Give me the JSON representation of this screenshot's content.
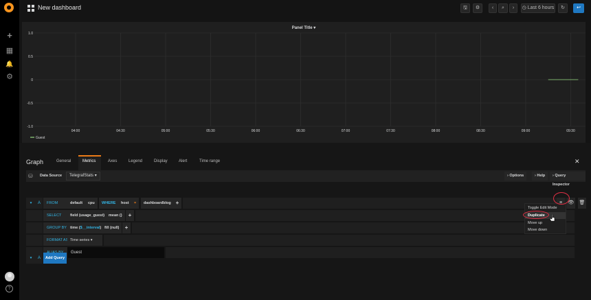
{
  "app": {
    "logo_icon": "grafana-logo-icon"
  },
  "sidebar": {
    "items": [
      {
        "icon": "plus-icon",
        "glyph": "+"
      },
      {
        "icon": "dashboards-icon",
        "glyph": "▦"
      },
      {
        "icon": "bell-icon",
        "glyph": "🔔"
      },
      {
        "icon": "gear-icon",
        "glyph": "⚙"
      }
    ],
    "help_glyph": "?"
  },
  "topnav": {
    "title": "New dashboard",
    "save_glyph": "🖫",
    "settings_glyph": "⚙",
    "back_glyph": "‹",
    "zoom_glyph": "⌕",
    "forward_glyph": "›",
    "time_range": "Last 6 hours",
    "time_icon": "clock-icon",
    "refresh_glyph": "↻",
    "return_glyph": "↩"
  },
  "panel": {
    "title": "Panel Title",
    "title_caret": "▾"
  },
  "chart_data": {
    "type": "line",
    "title": "Panel Title",
    "xlabel": "",
    "ylabel": "",
    "ylim": [
      -1.0,
      1.0
    ],
    "y_ticks": [
      "1.0",
      "0.5",
      "0",
      "-0.5",
      "-1.0"
    ],
    "x_ticks": [
      "04:00",
      "04:30",
      "05:00",
      "05:30",
      "06:00",
      "06:30",
      "07:00",
      "07:30",
      "08:00",
      "08:30",
      "09:00",
      "09:30"
    ],
    "grid": true,
    "legend_position": "bottom-left",
    "series": [
      {
        "name": "Guest",
        "color": "#7eb26d",
        "x": [
          "09:15",
          "09:35"
        ],
        "values": [
          0,
          0
        ]
      }
    ]
  },
  "editor": {
    "title": "Graph",
    "tabs": [
      "General",
      "Metrics",
      "Axes",
      "Legend",
      "Display",
      "Alert",
      "Time range"
    ],
    "active_tab": "Metrics",
    "close_glyph": "✕",
    "datasource": {
      "label": "Data Source",
      "value": "TelegrafStats",
      "caret": "▾",
      "options_btn": "Options",
      "help_btn": "Help",
      "inspector_btn": "Query Inspector"
    },
    "query": {
      "collapse": "▾",
      "letter": "A",
      "rows": {
        "from": {
          "label": "FROM",
          "policy": "default",
          "measurement": "cpu",
          "where_kw": "WHERE",
          "tag_key": "host",
          "operator": "=",
          "tag_value": "dashboardblog"
        },
        "select": {
          "label": "SELECT",
          "field": "field (usage_guest)",
          "fn": "mean ()"
        },
        "group_by": {
          "label": "GROUP BY",
          "time_pre": "time (",
          "time_var": "$__interval",
          "time_post": ")",
          "fill": "fill (null)"
        },
        "format_as": {
          "label": "FORMAT AS",
          "value": "Time series",
          "caret": "▾"
        },
        "alias_by": {
          "label": "ALIAS BY",
          "value": "Guest"
        }
      },
      "plus_glyph": "+",
      "menu_glyph": "≡",
      "eye_glyph": "👁",
      "trash_glyph": "🗑"
    },
    "add_query": {
      "letter": "A",
      "label": "Add Query"
    },
    "context_menu": {
      "items": [
        "Toggle Edit Mode",
        "Duplicate",
        "Move up",
        "Move down"
      ],
      "highlighted": "Duplicate"
    }
  },
  "colors": {
    "accent_blue": "#1f78c1",
    "keyword_blue": "#33b5e5",
    "orange": "#eb7b18",
    "annotation_red": "#e02f44",
    "series_green": "#7eb26d"
  }
}
